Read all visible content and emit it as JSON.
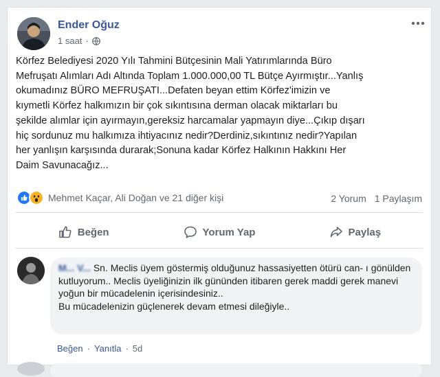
{
  "post": {
    "author": "Ender Oğuz",
    "time": "1 saat",
    "text": "Körfez Belediyesi 2020 Yılı Tahmini Bütçesinin Mali Yatırımlarında Büro\nMefruşatı Alımları Adı Altında Toplam 1.000.000,00 TL Bütçe Ayırmıştır...Yanlış\nokumadınız BÜRO MEFRUŞATI...Defaten beyan ettim Körfez'imizin ve\nkıymetli Körfez halkımızın bir çok sıkıntısına derman olacak miktarları bu\nşekilde alımlar için ayırmayın,gereksiz harcamalar yapmayın diye...Çıkıp dışarı\nhiç sordunuz mu halkımıza ihtiyacınız nedir?Derdiniz,sıkıntınız nedir?Yapılan\nher yanlışın karşısında durarak;Sonuna kadar Körfez Halkının Hakkını Her\nDaim Savunacağız...",
    "reaction_names": "Mehmet Kaçar, Ali Doğan ve 21 diğer kişi",
    "comments_count": "2 Yorum",
    "shares_count": "1 Paylaşım"
  },
  "actions": {
    "like": "Beğen",
    "comment": "Yorum Yap",
    "share": "Paylaş"
  },
  "comment": {
    "author": "M... V...",
    "text": "Sn. Meclis üyem göstermiş olduğunuz hassasiyetten ötürü can- ı gönülden kutluyorum.. Meclis üyeliğinizin ilk gününden itibaren gerek maddi gerek manevi yoğun bir mücadelenin içerisindesiniz..",
    "text2": "Bu mücadelenizin güçlenerek devam etmesi dileğiyle..",
    "like": "Beğen",
    "reply": "Yanıtla",
    "time": "5d"
  },
  "colors": {
    "link": "#385898",
    "like_blue": "#2078f4",
    "wow_yellow": "#f7b125"
  }
}
